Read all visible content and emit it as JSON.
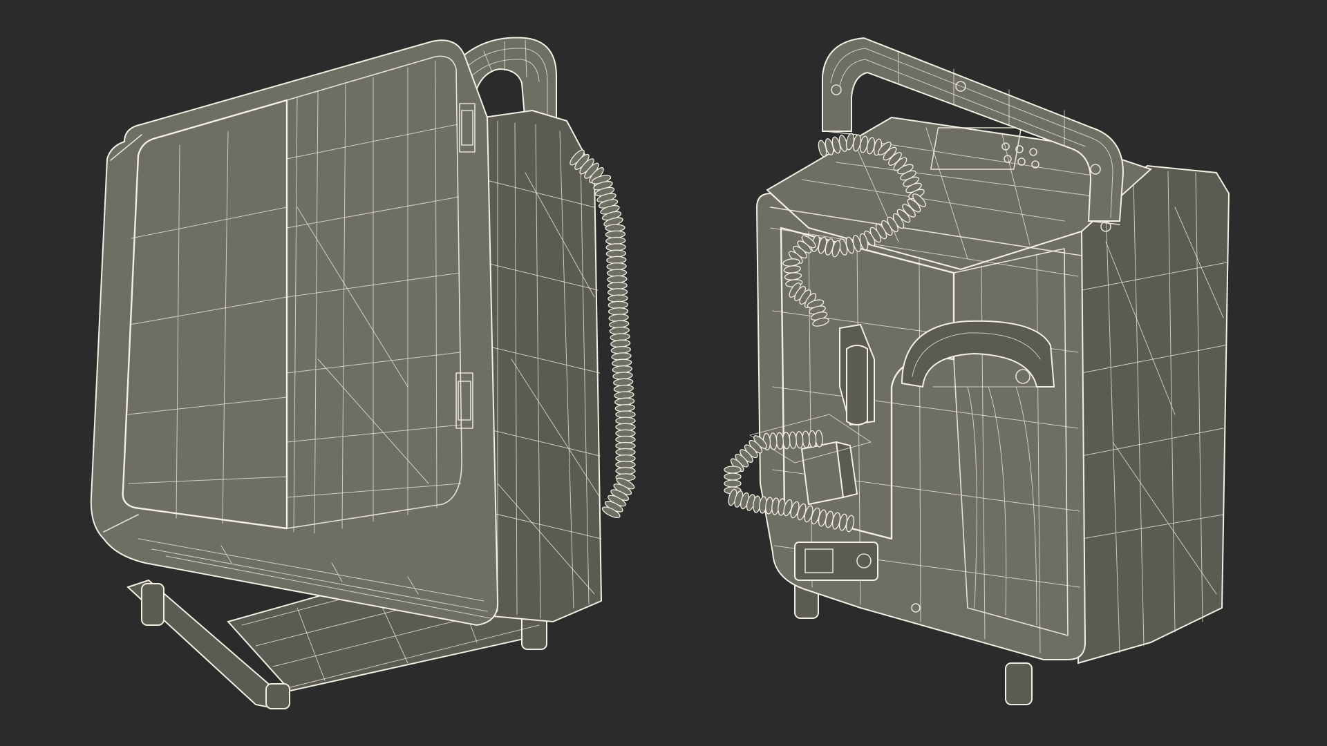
{
  "scene": {
    "background": "#2b2b2b",
    "surface_color": "#6f6e65",
    "surface_dark": "#5c5b53",
    "wire_color": "#f2f0e2",
    "objects": [
      {
        "name": "defibrillator-front-wireframe"
      },
      {
        "name": "defibrillator-rear-wireframe"
      }
    ]
  }
}
